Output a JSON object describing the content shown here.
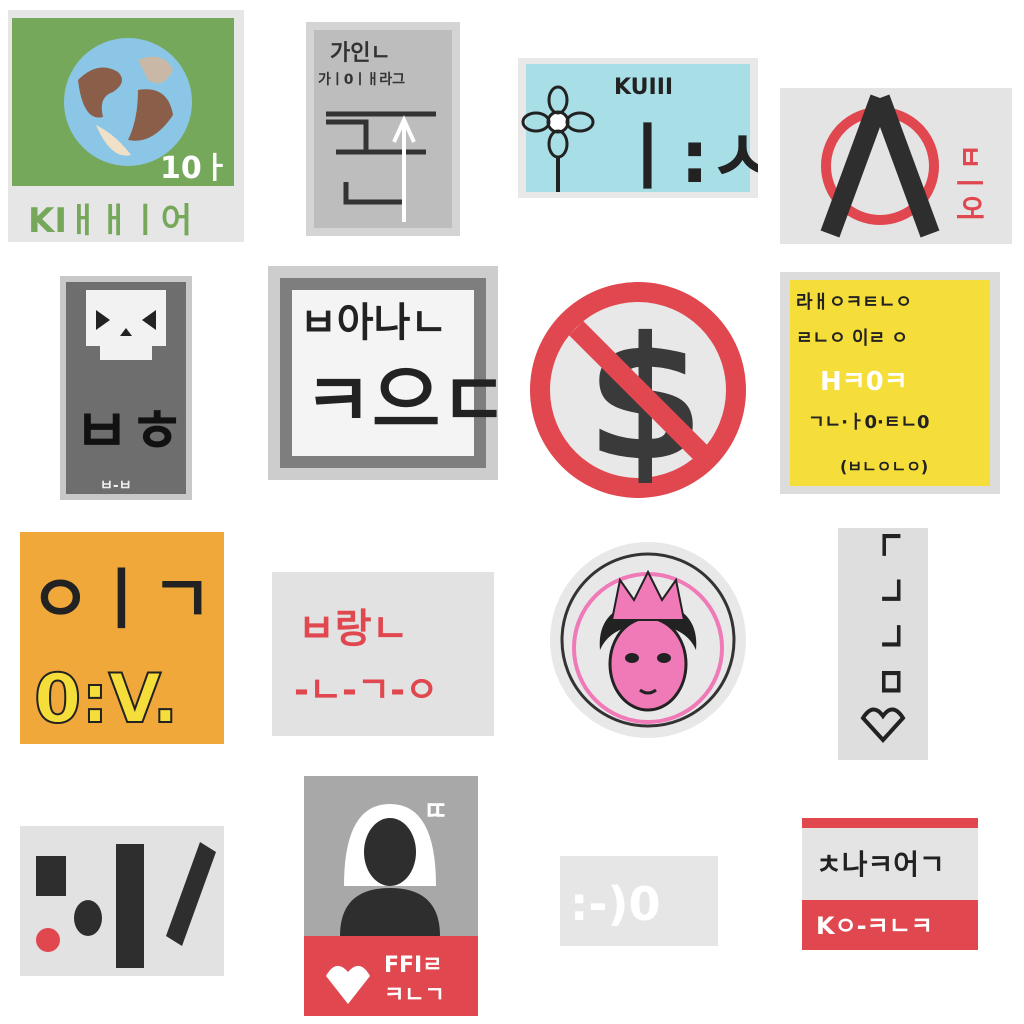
{
  "stickers": [
    {
      "name": "earth-sticker",
      "caption": "10ㅏ",
      "bottom_text": "KIㅐㅐㅣ어"
    },
    {
      "name": "arrow-road-sticker",
      "line1": "가인ㄴ",
      "line2": "가ㅣ0ㅣㅐ라그",
      "glyph": "ㅈ"
    },
    {
      "name": "flower-sticker",
      "top_text": "KUIII",
      "big_text": "ㅣ:ㅅ"
    },
    {
      "name": "compass-sticker",
      "right_text": "ㅂㅣ어"
    },
    {
      "name": "skull-sticker",
      "glyph": "ㅂㅎ",
      "small_text": "ㅂ-ㅂ"
    },
    {
      "name": "frame-text-sticker",
      "line1": "ㅂ아나ㄴ",
      "line2": "ㅋ으ㄷ"
    },
    {
      "name": "no-dollar-sticker",
      "symbol": "$"
    },
    {
      "name": "yellow-notice-sticker",
      "line1": "라ㅐㅇㅋㅌㄴㅇ",
      "line2": "ㄹㄴㅇ 이ㄹ ㅇ",
      "line3": "Hㅋ0ㅋ",
      "line4": "ㄱㄴ·ㅏ0·ㅌㄴ0",
      "line5": "(ㅂㄴㅇㄴㅇ)"
    },
    {
      "name": "orange-sticker",
      "line1": "ㅇㅣㄱ",
      "line2": "0:V."
    },
    {
      "name": "red-text-sticker",
      "line1": "ㅂ랑ㄴ",
      "line2": "-ㄴ-ㄱ-ㅇ"
    },
    {
      "name": "princess-sticker"
    },
    {
      "name": "vertical-text-sticker",
      "text": "ㄴ ㄱ ㄱ ㅁ"
    },
    {
      "name": "bold-strokes-sticker",
      "glyph": "ㅇㅣ/"
    },
    {
      "name": "bride-sticker",
      "bubble": "ㄸ",
      "banner_text": "FFIㄹ",
      "banner_text2": "ㅋㄴㄱ"
    },
    {
      "name": "faded-sticker",
      "text": ":-)0"
    },
    {
      "name": "red-stripe-sticker",
      "line1": "ㅊ나ㅋ어ㄱ",
      "line2": "Kㅇ-ㅋㄴㅋ"
    }
  ],
  "colors": {
    "green": "#76a85c",
    "blue": "#8cc6e6",
    "cyan": "#a8dfe6",
    "red": "#e0474f",
    "yellow": "#f6de3a",
    "orange": "#f0a83a",
    "pink": "#f07ab8",
    "dark": "#2e2e2e",
    "grey": "#d7d7d7"
  }
}
